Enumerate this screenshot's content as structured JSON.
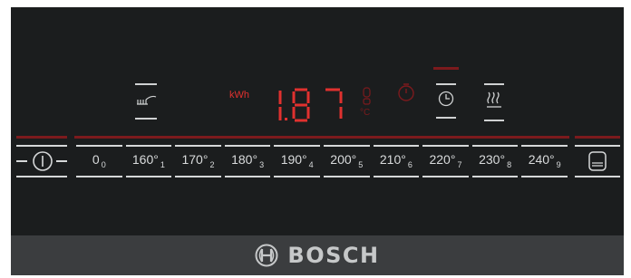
{
  "brand": {
    "name": "BOSCH"
  },
  "display": {
    "energy_unit": "kWh",
    "energy_value": "1.87"
  },
  "indicators": {
    "heating_mode_icon": "grill-heating-icon",
    "temp_unit_icon": "thermometer-icon",
    "timer_icon": "timer-icon",
    "clock_icon": "clock-icon",
    "steam_icon": "steam-icon"
  },
  "controls": {
    "power_icon": "power-icon",
    "right_icon": "menu-icon",
    "temperatures": [
      {
        "label": "0",
        "sub": "0"
      },
      {
        "label": "160°",
        "sub": "1"
      },
      {
        "label": "170°",
        "sub": "2"
      },
      {
        "label": "180°",
        "sub": "3"
      },
      {
        "label": "190°",
        "sub": "4"
      },
      {
        "label": "200°",
        "sub": "5"
      },
      {
        "label": "210°",
        "sub": "6"
      },
      {
        "label": "220°",
        "sub": "7"
      },
      {
        "label": "230°",
        "sub": "8"
      },
      {
        "label": "240°",
        "sub": "9"
      }
    ]
  },
  "colors": {
    "panel": "#1b1d1e",
    "segment_red": "#e0312f",
    "dim_red": "#7c1a1d",
    "strip": "#3b3d3f",
    "text": "#d9dbdc"
  }
}
